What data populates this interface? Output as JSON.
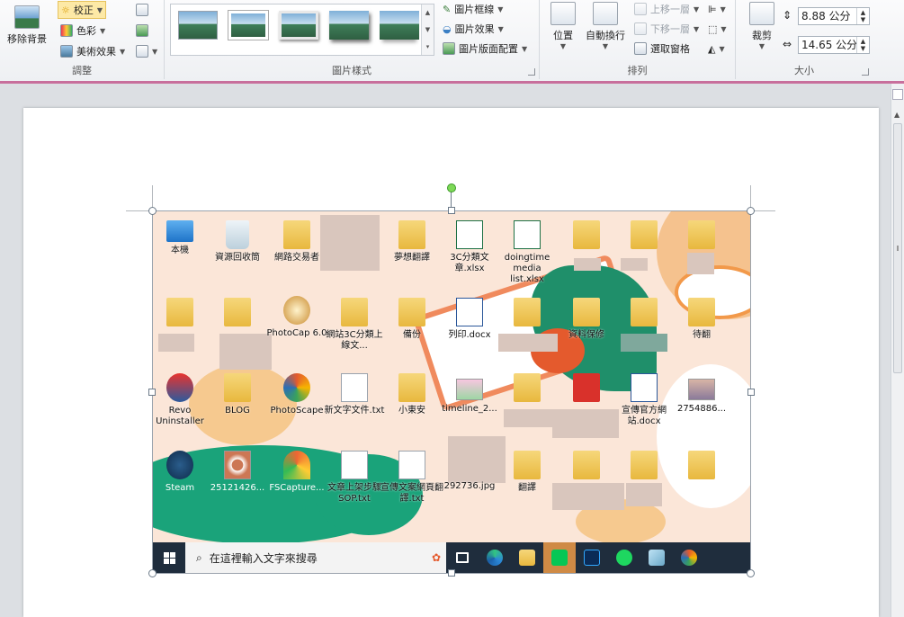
{
  "ribbon": {
    "adjust": {
      "group_label": "調整",
      "remove_bg": "移除背景",
      "corrections": "校正",
      "color": "色彩",
      "artistic": "美術效果"
    },
    "styles": {
      "group_label": "圖片樣式",
      "border": "圖片框線",
      "effects": "圖片效果",
      "layout": "圖片版面配置"
    },
    "arrange": {
      "group_label": "排列",
      "position": "位置",
      "wrap": "自動換行",
      "bring_forward": "上移一層",
      "send_backward": "下移一層",
      "selection_pane": "選取窗格"
    },
    "size": {
      "group_label": "大小",
      "crop": "裁剪",
      "height": "8.88 公分",
      "width": "14.65 公分"
    }
  },
  "desktop": {
    "icons": [
      {
        "label": "本機"
      },
      {
        "label": "資源回收筒"
      },
      {
        "label": "網路交易者"
      },
      {
        "label": "夢想翻譯"
      },
      {
        "label": "3C分類文章.xlsx"
      },
      {
        "label": "doingtime media list.xlsx"
      },
      {
        "label": "PhotoCap 6.0"
      },
      {
        "label": "網站3C分類上線文..."
      },
      {
        "label": "備份"
      },
      {
        "label": "列印.docx"
      },
      {
        "label": "資料保修"
      },
      {
        "label": "待翻"
      },
      {
        "label": "Revo Uninstaller"
      },
      {
        "label": "BLOG"
      },
      {
        "label": "PhotoScape"
      },
      {
        "label": "新文字文件.txt"
      },
      {
        "label": "小東安"
      },
      {
        "label": "timeline_2..."
      },
      {
        "label": "宣傳官方網站.docx"
      },
      {
        "label": "2754886..."
      },
      {
        "label": "Steam"
      },
      {
        "label": "25121426..."
      },
      {
        "label": "FSCapture..."
      },
      {
        "label": "文章上架步驟SOP.txt"
      },
      {
        "label": "宣傳文案網頁翻譯.txt"
      },
      {
        "label": "292736.jpg"
      },
      {
        "label": "翻譯"
      }
    ],
    "taskbar": {
      "search_placeholder": "在這裡輸入文字來搜尋",
      "apps": [
        "task-view",
        "edge",
        "file-explorer",
        "line",
        "photoshop",
        "spotify",
        "notepad",
        "photoscape"
      ]
    }
  },
  "colors": {
    "accent": "#c86f9c",
    "corrections_active": "#fde9a6",
    "taskbar": "#1f2d3d",
    "desktop_bg": "#fbe6d8",
    "green": "#1aa37a",
    "red": "#e45a2d"
  }
}
